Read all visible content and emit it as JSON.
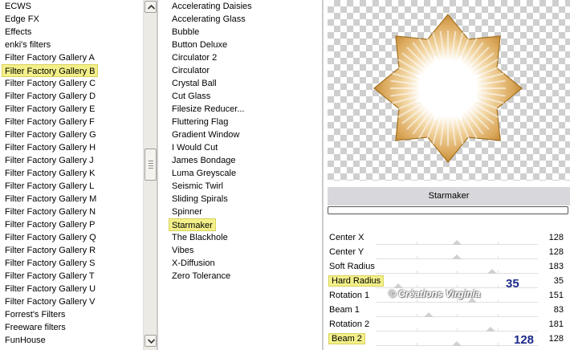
{
  "categories": {
    "items": [
      {
        "label": "ECWS"
      },
      {
        "label": "Edge FX"
      },
      {
        "label": "Effects"
      },
      {
        "label": "enki's filters"
      },
      {
        "label": "Filter Factory Gallery A"
      },
      {
        "label": "Filter Factory Gallery B",
        "highlighted": true
      },
      {
        "label": "Filter Factory Gallery C"
      },
      {
        "label": "Filter Factory Gallery D"
      },
      {
        "label": "Filter Factory Gallery E"
      },
      {
        "label": "Filter Factory Gallery F"
      },
      {
        "label": "Filter Factory Gallery G"
      },
      {
        "label": "Filter Factory Gallery H"
      },
      {
        "label": "Filter Factory Gallery J"
      },
      {
        "label": "Filter Factory Gallery K"
      },
      {
        "label": "Filter Factory Gallery L"
      },
      {
        "label": "Filter Factory Gallery M"
      },
      {
        "label": "Filter Factory Gallery N"
      },
      {
        "label": "Filter Factory Gallery P"
      },
      {
        "label": "Filter Factory Gallery Q"
      },
      {
        "label": "Filter Factory Gallery R"
      },
      {
        "label": "Filter Factory Gallery S"
      },
      {
        "label": "Filter Factory Gallery T"
      },
      {
        "label": "Filter Factory Gallery U"
      },
      {
        "label": "Filter Factory Gallery V"
      },
      {
        "label": "Forrest's Filters"
      },
      {
        "label": "Freeware filters"
      },
      {
        "label": "FunHouse"
      }
    ]
  },
  "filters": {
    "items": [
      {
        "label": "Accelerating Daisies"
      },
      {
        "label": "Accelerating Glass"
      },
      {
        "label": "Bubble"
      },
      {
        "label": "Button Deluxe"
      },
      {
        "label": "Circulator 2"
      },
      {
        "label": "Circulator"
      },
      {
        "label": "Crystal Ball"
      },
      {
        "label": "Cut Glass"
      },
      {
        "label": "Filesize Reducer..."
      },
      {
        "label": "Fluttering Flag"
      },
      {
        "label": "Gradient Window"
      },
      {
        "label": "I Would Cut"
      },
      {
        "label": "James Bondage"
      },
      {
        "label": "Luma Greyscale"
      },
      {
        "label": "Seismic Twirl"
      },
      {
        "label": "Sliding Spirals"
      },
      {
        "label": "Spinner"
      },
      {
        "label": "Starmaker",
        "highlighted": true
      },
      {
        "label": "The Blackhole"
      },
      {
        "label": "Vibes"
      },
      {
        "label": "X-Diffusion"
      },
      {
        "label": "Zero Tolerance"
      }
    ]
  },
  "panel": {
    "filter_name": "Starmaker",
    "progress": 0,
    "params": [
      {
        "label": "Center X",
        "value": "128",
        "level": 128
      },
      {
        "label": "Center Y",
        "value": "128",
        "level": 128
      },
      {
        "label": "Soft Radius",
        "value": "183",
        "level": 183
      },
      {
        "label": "Hard Radius",
        "value": "35",
        "level": 35,
        "highlighted": true
      },
      {
        "label": "Rotation 1",
        "value": "151",
        "level": 151
      },
      {
        "label": "Beam 1",
        "value": "83",
        "level": 83
      },
      {
        "label": "Rotation 2",
        "value": "181",
        "level": 181
      },
      {
        "label": "Beam 2",
        "value": "128",
        "level": 128,
        "highlighted": true
      }
    ],
    "level_max": 255,
    "annotations": {
      "hard_radius": "35",
      "beam_2": "128"
    }
  },
  "watermark": "© Créations Virginia",
  "colors": {
    "highlight": "#f3f08a",
    "annotation": "#1b2a8a",
    "star_outer": "#b07820",
    "star_mid": "#e3b56a",
    "star_inner": "#ffffff"
  },
  "icons": {
    "scroll_up": "chevron-up-icon",
    "scroll_down": "chevron-down-icon"
  }
}
